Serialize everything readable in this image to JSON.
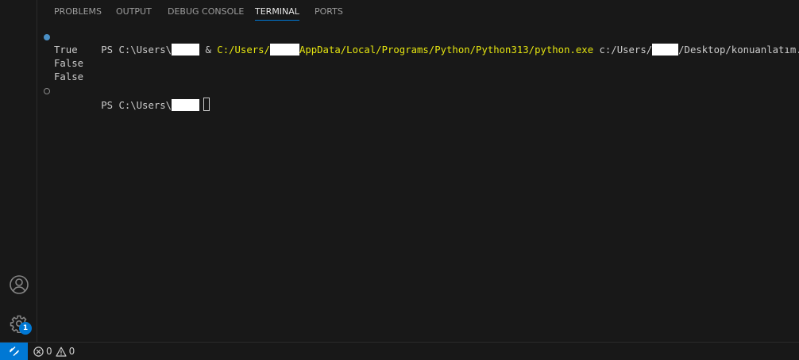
{
  "panel": {
    "tabs": [
      {
        "label": "PROBLEMS",
        "active": false
      },
      {
        "label": "OUTPUT",
        "active": false
      },
      {
        "label": "DEBUG CONSOLE",
        "active": false
      },
      {
        "label": "TERMINAL",
        "active": true
      },
      {
        "label": "PORTS",
        "active": false
      }
    ]
  },
  "terminal": {
    "command_line": {
      "prompt_prefix": "PS C:\\Users\\",
      "amp": " & ",
      "exe_path_start": "C:/Users/",
      "exe_path_end": "AppData/Local/Programs/Python/Python313/python.exe",
      "script_path_start": " c:/Users/",
      "script_path_end": "/Desktop/konuanlatım.py"
    },
    "output": [
      "True",
      "False",
      "False"
    ],
    "idle_prompt": "PS C:\\Users\\"
  },
  "activity_bar": {
    "account_icon": "account-icon",
    "manage_icon": "gear-icon",
    "manage_badge": "1"
  },
  "status_bar": {
    "remote_icon": "remote-icon",
    "errors": "0",
    "warnings": "0"
  },
  "colors": {
    "background": "#181818",
    "accent": "#0078d4",
    "command_yellow": "#e5e510",
    "text": "#cccccc"
  }
}
